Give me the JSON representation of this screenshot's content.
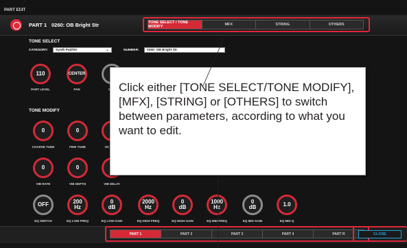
{
  "window": {
    "title": "PART EDIT"
  },
  "header": {
    "part": "PART 1",
    "tone": "0260: OB Bright Str"
  },
  "tabs": [
    {
      "label": "TONE SELECT / TONE MODIFY",
      "active": true
    },
    {
      "label": "MFX",
      "active": false
    },
    {
      "label": "STRING",
      "active": false
    },
    {
      "label": "OTHERS",
      "active": false
    }
  ],
  "tone_select": {
    "title": "TONE SELECT",
    "category_label": "CATEGORY:",
    "category_value": "Synth Pad/Str",
    "number_label": "NUMBER:",
    "number_value": "0260: OB Bright Str",
    "knobs": [
      {
        "value": "110",
        "label": "PART LEVEL"
      },
      {
        "value": "CENTER",
        "label": "PAN"
      },
      {
        "value": "",
        "label": "CHO"
      }
    ]
  },
  "tone_modify": {
    "title": "TONE MODIFY",
    "row1": [
      {
        "value": "0",
        "label": "COARSE TUNE"
      },
      {
        "value": "0",
        "label": "FINE TUNE"
      },
      {
        "value": "",
        "label": "OC"
      }
    ],
    "row2": [
      {
        "value": "0",
        "label": "VIB RATE"
      },
      {
        "value": "0",
        "label": "VIB DEPTH"
      },
      {
        "value": "",
        "label": "VIB DELAY"
      }
    ],
    "row3": [
      {
        "value": "OFF",
        "unit": "",
        "label": "EQ SWITCH"
      },
      {
        "value": "200",
        "unit": "Hz",
        "label": "EQ LOW FREQ"
      },
      {
        "value": "0",
        "unit": "dB",
        "label": "EQ LOW GAIN"
      },
      {
        "value": "2000",
        "unit": "Hz",
        "label": "EQ HIGH FREQ"
      },
      {
        "value": "0",
        "unit": "dB",
        "label": "EQ HIGH GAIN"
      },
      {
        "value": "1000",
        "unit": "Hz",
        "label": "EQ MID FREQ"
      },
      {
        "value": "0",
        "unit": "dB",
        "label": "EQ MID GAIN"
      },
      {
        "value": "1.0",
        "unit": "",
        "label": "EQ MID Q"
      }
    ]
  },
  "callout": {
    "text": "Click either [TONE SELECT/TONE MODIFY], [MFX], [STRING] or [OTHERS] to switch between parameters, according to what you want to edit."
  },
  "part_tabs": [
    {
      "label": "PART 1",
      "active": true
    },
    {
      "label": "PART 2",
      "active": false
    },
    {
      "label": "PART 3",
      "active": false
    },
    {
      "label": "PART 4",
      "active": false
    },
    {
      "label": "PART R",
      "active": false
    }
  ],
  "close_button": {
    "label": "CLOSE"
  },
  "colors": {
    "accent": "#d42a38",
    "knob_gray": "#8c8c8c",
    "close_blue": "#2aa0d8"
  }
}
